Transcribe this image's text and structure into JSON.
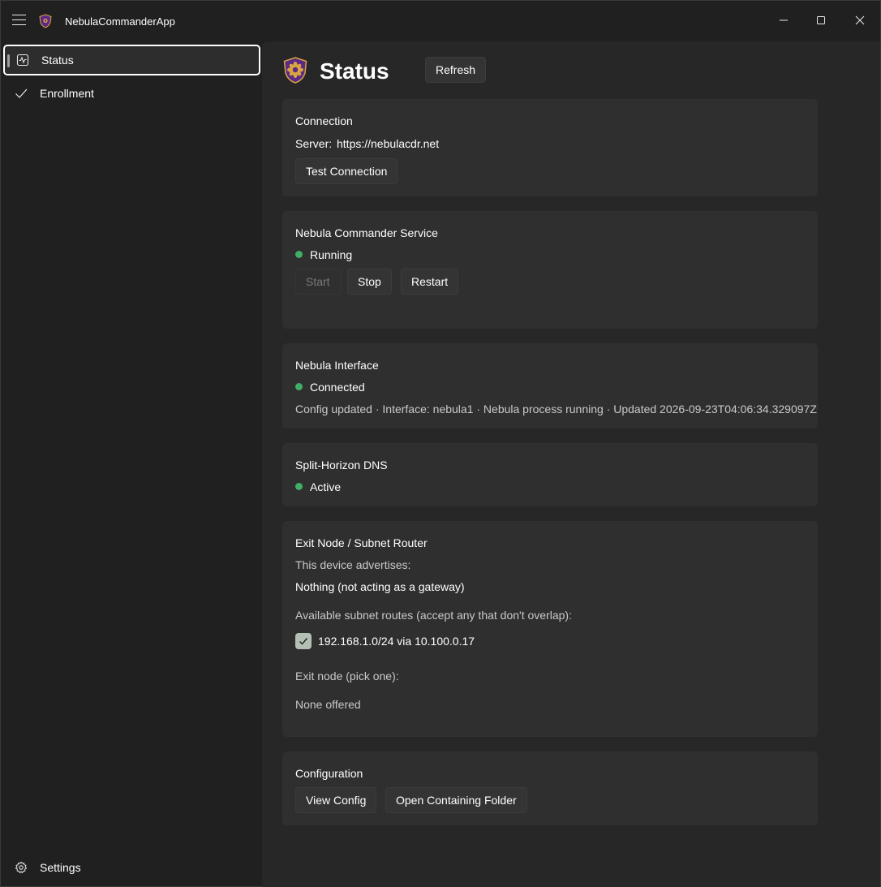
{
  "window": {
    "title": "NebulaCommanderApp"
  },
  "sidebar": {
    "items": [
      {
        "label": "Status",
        "icon": "activity-icon",
        "selected": true
      },
      {
        "label": "Enrollment",
        "icon": "checkmark-icon",
        "selected": false
      }
    ],
    "footer": {
      "label": "Settings",
      "icon": "gear-icon"
    }
  },
  "page": {
    "title": "Status",
    "refresh_label": "Refresh"
  },
  "connection": {
    "title": "Connection",
    "server_label": "Server:",
    "server_value": "https://nebulacdr.net",
    "test_button": "Test Connection"
  },
  "service": {
    "title": "Nebula Commander Service",
    "status": "Running",
    "status_color": "#3fae66",
    "start_button": "Start",
    "stop_button": "Stop",
    "restart_button": "Restart"
  },
  "interface": {
    "title": "Nebula Interface",
    "status": "Connected",
    "status_color": "#3fae66",
    "detail": "Config updated · Interface: nebula1 · Nebula process running · Updated 2026-09-23T04:06:34.329097Z"
  },
  "dns": {
    "title": "Split-Horizon DNS",
    "status": "Active",
    "status_color": "#3fae66"
  },
  "exit_node": {
    "title": "Exit Node / Subnet Router",
    "advertises_label": "This device advertises:",
    "advertises_value": "Nothing (not acting as a gateway)",
    "routes_label": "Available subnet routes (accept any that don't overlap):",
    "routes": [
      {
        "label": "192.168.1.0/24 via 10.100.0.17",
        "checked": true
      }
    ],
    "exit_label": "Exit node (pick one):",
    "exit_value": "None offered"
  },
  "configuration": {
    "title": "Configuration",
    "view_button": "View Config",
    "open_folder_button": "Open Containing Folder"
  },
  "colors": {
    "background": "#202020",
    "content": "#272727",
    "card": "#2f2f2f",
    "accent_green": "#3fae66",
    "logo_purple": "#5b2a86",
    "logo_gold": "#d9a441"
  }
}
